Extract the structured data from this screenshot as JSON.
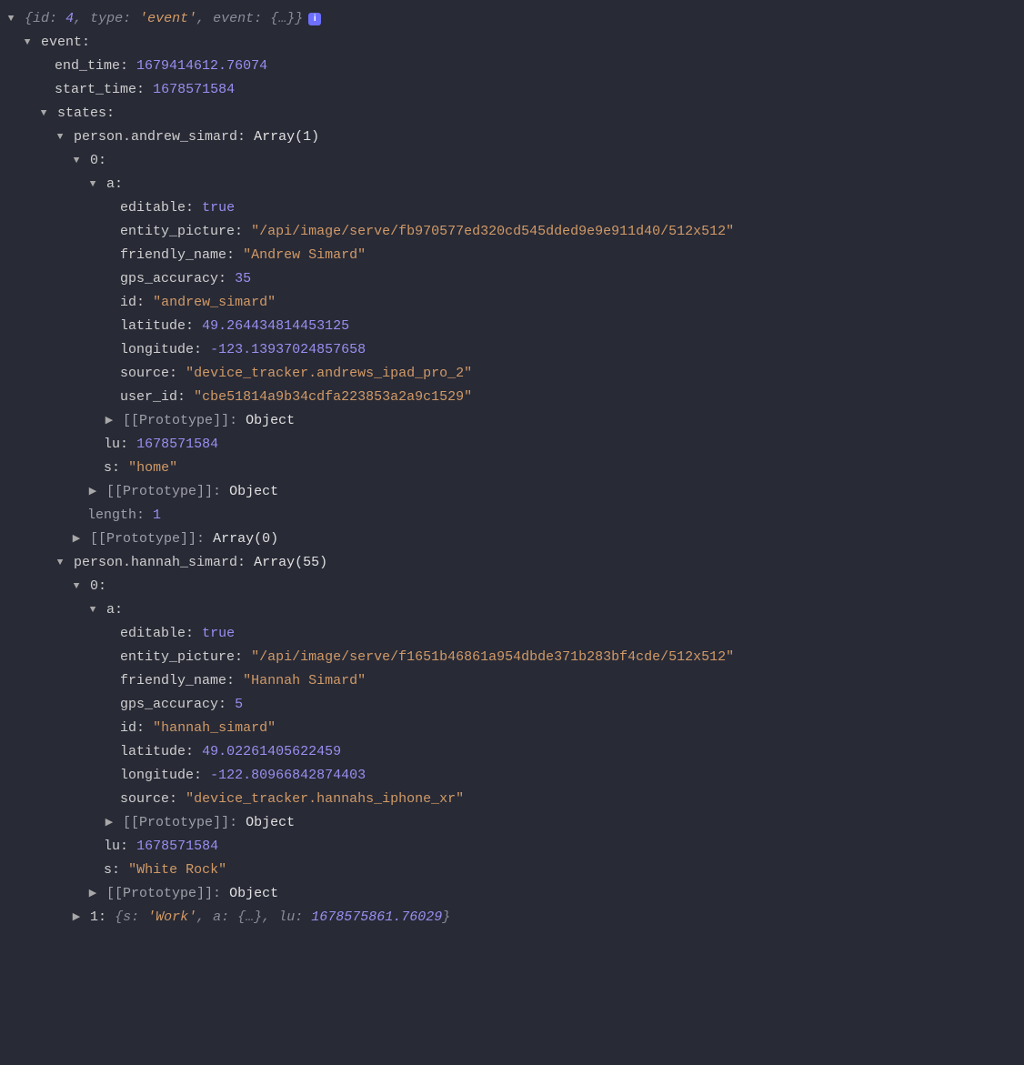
{
  "root_preview": {
    "id_key": "id",
    "id_val": "4",
    "type_key": "type",
    "type_val": "'event'",
    "event_key": "event",
    "event_val": "{…}"
  },
  "badge_label": "i",
  "event": {
    "label": "event:",
    "end_time": {
      "k": "end_time:",
      "v": "1679414612.76074"
    },
    "start_time": {
      "k": "start_time:",
      "v": "1678571584"
    },
    "states_label": "states:"
  },
  "andrew": {
    "header_key": "person.andrew_simard:",
    "header_type": "Array(1)",
    "idx0": "0:",
    "a_label": "a:",
    "editable": {
      "k": "editable:",
      "v": "true"
    },
    "entity_picture": {
      "k": "entity_picture:",
      "v": "\"/api/image/serve/fb970577ed320cd545dded9e9e911d40/512x512\""
    },
    "friendly_name": {
      "k": "friendly_name:",
      "v": "\"Andrew Simard\""
    },
    "gps_accuracy": {
      "k": "gps_accuracy:",
      "v": "35"
    },
    "id": {
      "k": "id:",
      "v": "\"andrew_simard\""
    },
    "latitude": {
      "k": "latitude:",
      "v": "49.264434814453125"
    },
    "longitude": {
      "k": "longitude:",
      "v": "-123.13937024857658"
    },
    "source": {
      "k": "source:",
      "v": "\"device_tracker.andrews_ipad_pro_2\""
    },
    "user_id": {
      "k": "user_id:",
      "v": "\"cbe51814a9b34cdfa223853a2a9c1529\""
    },
    "proto_a": {
      "k": "[[Prototype]]:",
      "v": "Object"
    },
    "lu": {
      "k": "lu:",
      "v": "1678571584"
    },
    "s": {
      "k": "s:",
      "v": "\"home\""
    },
    "proto_idx": {
      "k": "[[Prototype]]:",
      "v": "Object"
    },
    "length": {
      "k": "length:",
      "v": "1"
    },
    "proto_arr": {
      "k": "[[Prototype]]:",
      "v": "Array(0)"
    }
  },
  "hannah": {
    "header_key": "person.hannah_simard:",
    "header_type": "Array(55)",
    "idx0": "0:",
    "a_label": "a:",
    "editable": {
      "k": "editable:",
      "v": "true"
    },
    "entity_picture": {
      "k": "entity_picture:",
      "v": "\"/api/image/serve/f1651b46861a954dbde371b283bf4cde/512x512\""
    },
    "friendly_name": {
      "k": "friendly_name:",
      "v": "\"Hannah Simard\""
    },
    "gps_accuracy": {
      "k": "gps_accuracy:",
      "v": "5"
    },
    "id": {
      "k": "id:",
      "v": "\"hannah_simard\""
    },
    "latitude": {
      "k": "latitude:",
      "v": "49.02261405622459"
    },
    "longitude": {
      "k": "longitude:",
      "v": "-122.80966842874403"
    },
    "source": {
      "k": "source:",
      "v": "\"device_tracker.hannahs_iphone_xr\""
    },
    "proto_a": {
      "k": "[[Prototype]]:",
      "v": "Object"
    },
    "lu": {
      "k": "lu:",
      "v": "1678571584"
    },
    "s": {
      "k": "s:",
      "v": "\"White Rock\""
    },
    "proto_idx": {
      "k": "[[Prototype]]:",
      "v": "Object"
    },
    "idx1_key": "1:",
    "idx1_preview": {
      "s_k": "s:",
      "s_v": "'Work'",
      "a_k": "a:",
      "a_v": "{…}",
      "lu_k": "lu:",
      "lu_v": "1678575861.76029"
    }
  }
}
